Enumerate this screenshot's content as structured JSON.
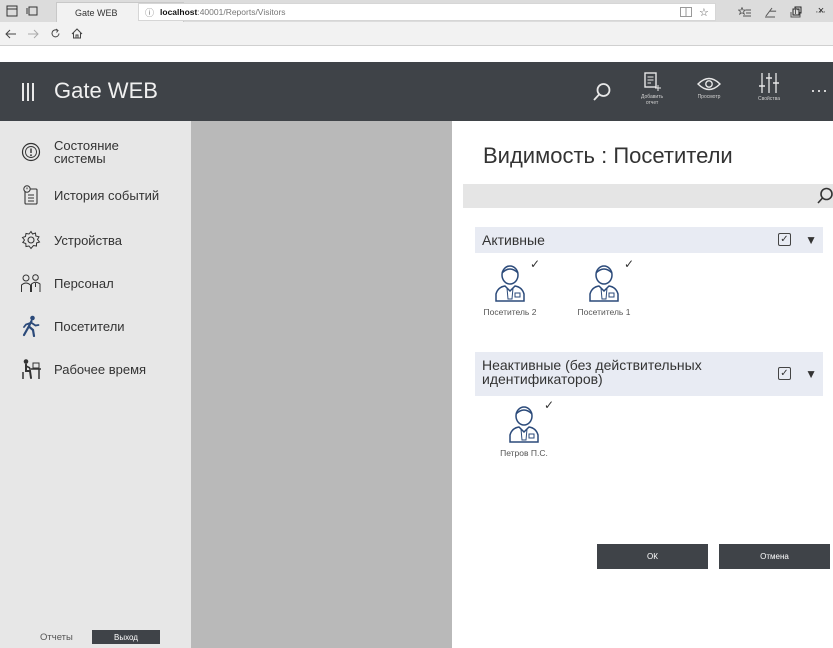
{
  "browser": {
    "tab_title": "Gate WEB",
    "tab_close": "×",
    "new_tab": "+",
    "tab_chevron": "∨",
    "url_host": "localhost",
    "url_path": ":40001/Reports/Visitors",
    "window_minimize": "–",
    "window_restore": "▫",
    "window_close": "×"
  },
  "header": {
    "app_title": "Gate WEB",
    "buttons": [
      {
        "label_line1": "Добавить",
        "label_line2": "отчет",
        "icon": "add-report-icon"
      },
      {
        "label_line1": "Просмотр",
        "label_line2": "",
        "icon": "eye-icon"
      },
      {
        "label_line1": "Свойства",
        "label_line2": "",
        "icon": "sliders-icon"
      }
    ],
    "more": "···"
  },
  "sidebar": {
    "items": [
      {
        "label_line1": "Состояние",
        "label_line2": "системы",
        "icon": "system-status-icon"
      },
      {
        "label_line1": "История событий",
        "label_line2": "",
        "icon": "event-history-icon"
      },
      {
        "label_line1": "Устройства",
        "label_line2": "",
        "icon": "devices-gear-icon"
      },
      {
        "label_line1": "Персонал",
        "label_line2": "",
        "icon": "personnel-icon"
      },
      {
        "label_line1": "Посетители",
        "label_line2": "",
        "icon": "visitor-walking-icon"
      },
      {
        "label_line1": "Рабочее время",
        "label_line2": "",
        "icon": "working-time-icon"
      }
    ],
    "footer_reports": "Отчеты",
    "footer_exit": "Выход"
  },
  "panel": {
    "title": "Видимость : Посетители",
    "search_value": "",
    "groups": [
      {
        "title_line1": "Активные",
        "title_line2": "",
        "checked": true,
        "visitors": [
          {
            "name": "Посетитель 2",
            "checked": true
          },
          {
            "name": "Посетитель 1",
            "checked": true
          }
        ]
      },
      {
        "title_line1": "Неактивные (без действительных",
        "title_line2": "идентификаторов)",
        "checked": true,
        "visitors": [
          {
            "name": "Петров П.С.",
            "checked": true
          }
        ]
      }
    ],
    "ok_label": "ОК",
    "cancel_label": "Отмена"
  },
  "colors": {
    "header_bg": "#3f4348",
    "sidebar_bg": "#e7e7e7",
    "middle_bg": "#b9b9b9",
    "group_bg": "#e8ebf3",
    "icon_blue": "#2b4a7a"
  }
}
